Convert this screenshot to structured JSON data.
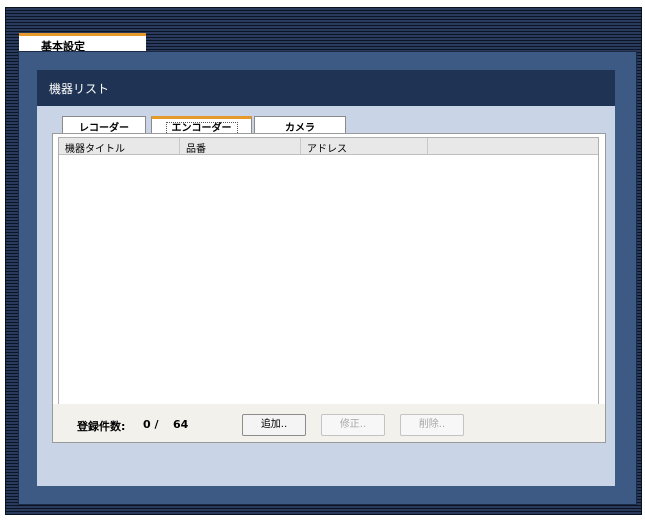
{
  "top_tab": {
    "label": "基本設定"
  },
  "section": {
    "title": "機器リスト"
  },
  "tabs": [
    {
      "label": "レコーダー",
      "active": false
    },
    {
      "label": "エンコーダー",
      "active": true
    },
    {
      "label": "カメラ",
      "active": false
    }
  ],
  "table": {
    "columns": [
      "機器タイトル",
      "品番",
      "アドレス",
      ""
    ],
    "rows": []
  },
  "footer": {
    "count_label": "登録件数:",
    "count_value": "0 /",
    "count_max": "64",
    "add_label": "追加..",
    "edit_label": "修正..",
    "delete_label": "削除.."
  },
  "colors": {
    "accent": "#e39a2a",
    "panel": "#3d5a85",
    "header": "#1f3454",
    "inner_bg": "#c9d4e6"
  }
}
